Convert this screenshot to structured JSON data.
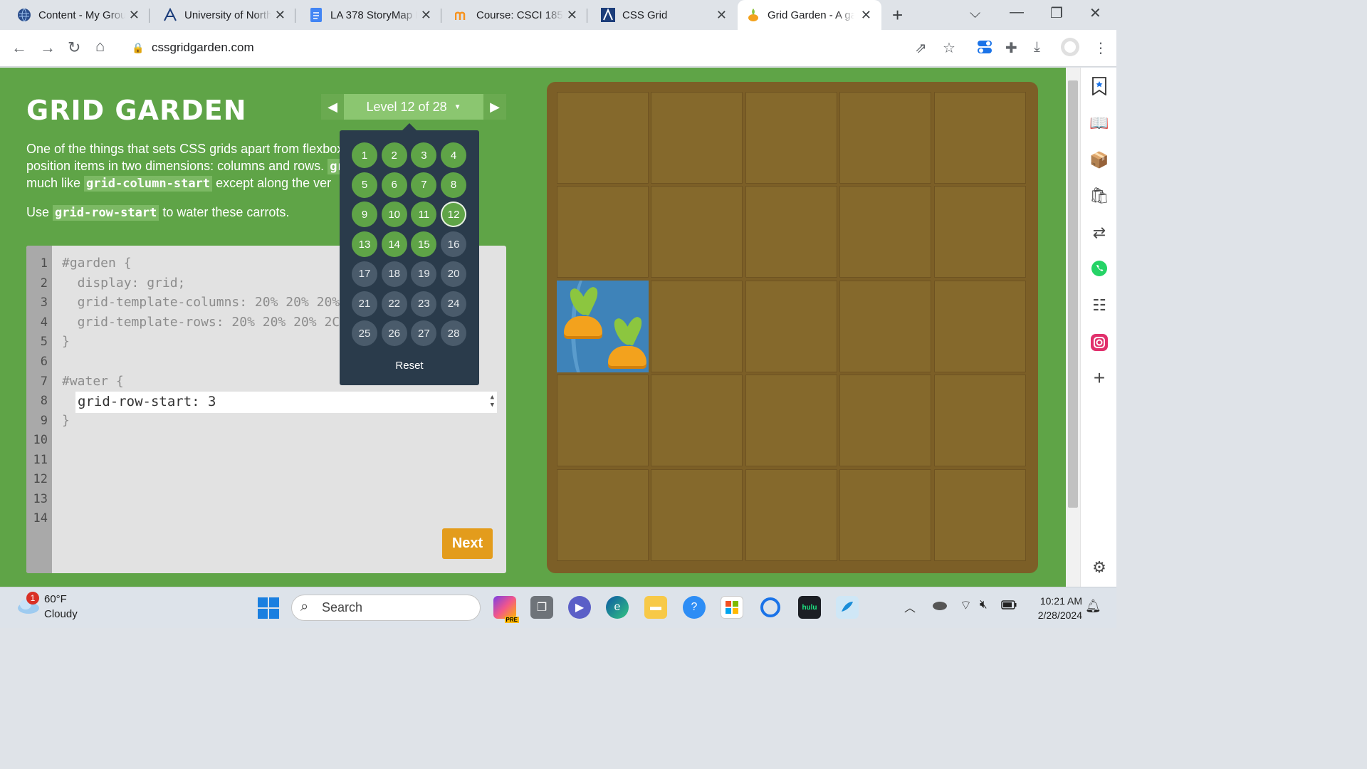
{
  "browser": {
    "tabs": [
      {
        "title": "Content - My Group",
        "icon": "globe-icon"
      },
      {
        "title": "University of North",
        "icon": "ut-logo-icon"
      },
      {
        "title": "LA 378 StoryMap P",
        "icon": "docs-icon"
      },
      {
        "title": "Course: CSCI 185:",
        "icon": "moodle-icon"
      },
      {
        "title": "CSS Grid",
        "icon": "ut-logo-icon"
      },
      {
        "title": "Grid Garden - A ga",
        "icon": "carrot-icon"
      }
    ],
    "active_tab": 5,
    "url": "cssgridgarden.com"
  },
  "game": {
    "title": "GRID GARDEN",
    "level_label": "Level 12 of 28",
    "intro_a": "One of the things that sets CSS grids apart from flexbox",
    "intro_b": "position items in two dimensions: columns and rows.",
    "intro_b_code": "gr",
    "intro_c": "much like",
    "intro_c_code": "grid-column-start",
    "intro_c_tail": "except along the ver",
    "task_prefix": "Use",
    "task_code": "grid-row-start",
    "task_suffix": "to water these carrots.",
    "code_lines": [
      "#garden {",
      "  display: grid;",
      "  grid-template-columns: 20% 20% 20%",
      "  grid-template-rows: 20% 20% 20% 2C",
      "}",
      "",
      "#water {",
      "",
      "}"
    ],
    "line_numbers": [
      "1",
      "2",
      "3",
      "4",
      "5",
      "6",
      "7",
      "8",
      "9",
      "10",
      "11",
      "12",
      "13",
      "14"
    ],
    "answer": "grid-row-start: 3",
    "next_label": "Next",
    "levels": [
      "1",
      "2",
      "3",
      "4",
      "5",
      "6",
      "7",
      "8",
      "9",
      "10",
      "11",
      "12",
      "13",
      "14",
      "15",
      "16",
      "17",
      "18",
      "19",
      "20",
      "21",
      "22",
      "23",
      "24",
      "25",
      "26",
      "27",
      "28"
    ],
    "current_level": 12,
    "completed_levels": 15,
    "reset_label": "Reset",
    "water_cell": {
      "row": 3,
      "column": 1
    }
  },
  "taskbar": {
    "weather_temp": "60°F",
    "weather_desc": "Cloudy",
    "weather_badge": "1",
    "search_placeholder": "Search",
    "time": "10:21 AM",
    "date": "2/28/2024",
    "hulu_label": "hulu",
    "pre_label": "PRE"
  }
}
